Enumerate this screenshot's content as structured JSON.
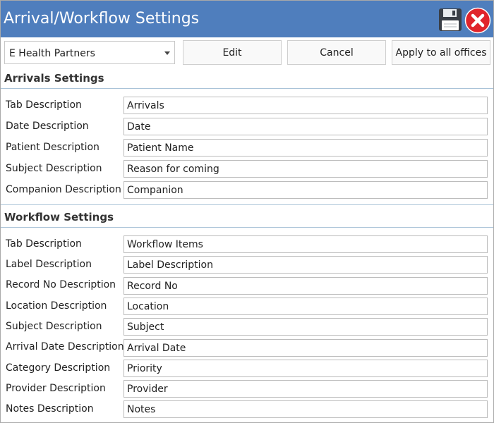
{
  "window": {
    "title": "Arrival/Workflow Settings"
  },
  "toolbar": {
    "office_selected": "E Health Partners",
    "edit_label": "Edit",
    "cancel_label": "Cancel",
    "apply_label": "Apply to all offices"
  },
  "arrivals": {
    "header": "Arrivals Settings",
    "fields": [
      {
        "label": "Tab Description",
        "value": "Arrivals"
      },
      {
        "label": "Date Description",
        "value": "Date"
      },
      {
        "label": "Patient Description",
        "value": "Patient Name"
      },
      {
        "label": "Subject Description",
        "value": "Reason for coming"
      },
      {
        "label": "Companion Description",
        "value": "Companion"
      }
    ]
  },
  "workflow": {
    "header": "Workflow Settings",
    "fields": [
      {
        "label": "Tab Description",
        "value": "Workflow Items"
      },
      {
        "label": "Label Description",
        "value": "Label Description"
      },
      {
        "label": "Record No Description",
        "value": "Record No"
      },
      {
        "label": "Location Description",
        "value": "Location"
      },
      {
        "label": "Subject Description",
        "value": "Subject"
      },
      {
        "label": "Arrival Date Description",
        "value": "Arrival Date"
      },
      {
        "label": "Category Description",
        "value": "Priority"
      },
      {
        "label": "Provider Description",
        "value": "Provider"
      },
      {
        "label": "Notes Description",
        "value": "Notes"
      }
    ]
  },
  "icons": {
    "save": "floppy-disk-icon",
    "close": "close-icon"
  },
  "colors": {
    "titlebar": "#4f7ebd",
    "close_red": "#e0242b",
    "section_rule": "#aac3d8"
  }
}
